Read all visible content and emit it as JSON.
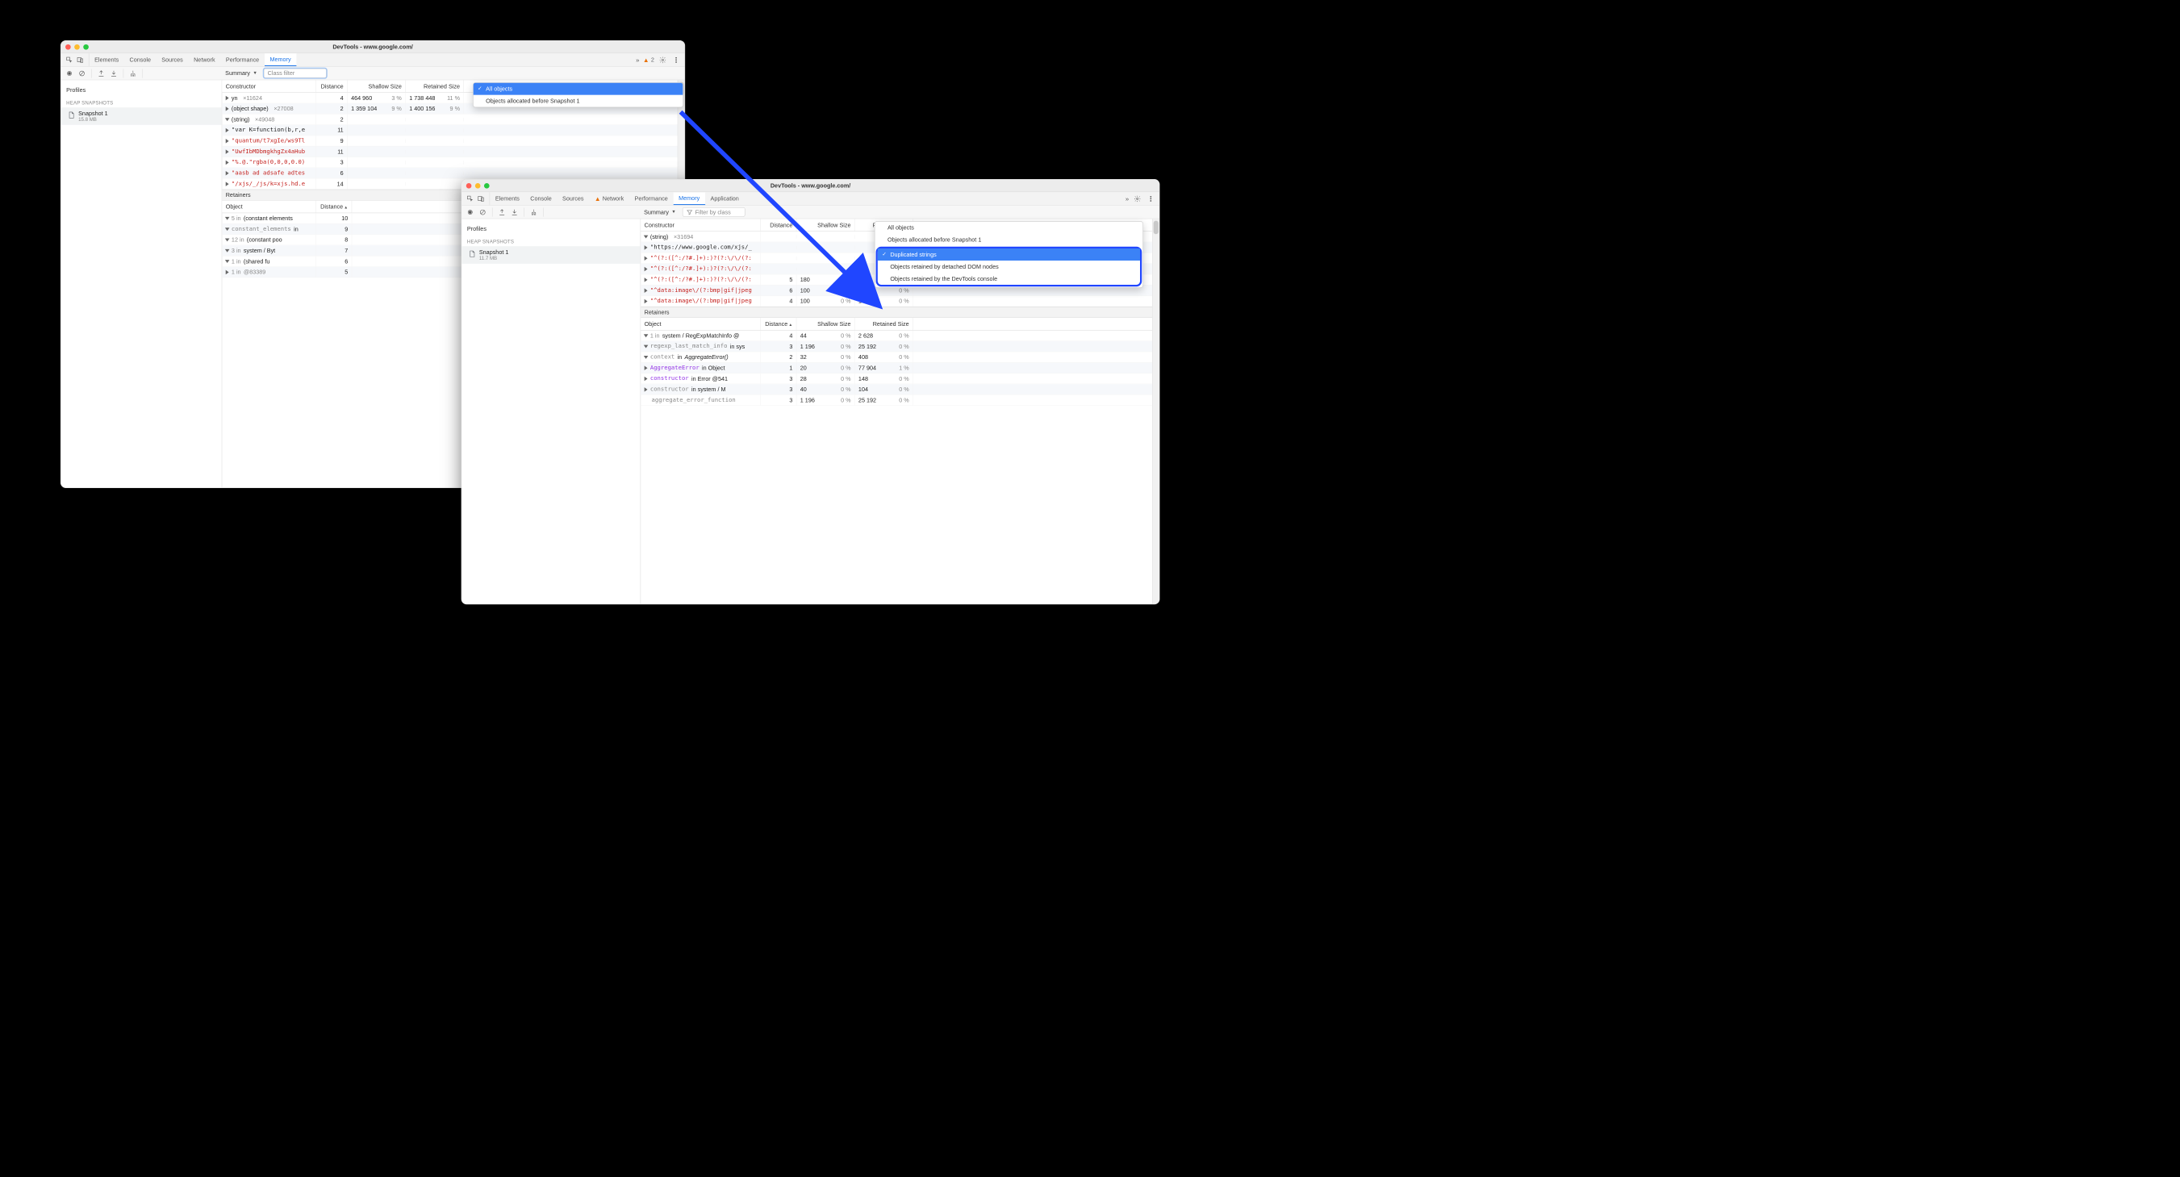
{
  "window1": {
    "title": "DevTools - www.google.com/",
    "tabs": [
      "Elements",
      "Console",
      "Sources",
      "Network",
      "Performance",
      "Memory"
    ],
    "active_tab": "Memory",
    "overflow_glyph": "»",
    "warn_count": "2",
    "toolbar": {
      "summary": "Summary",
      "class_filter_placeholder": "Class filter"
    },
    "dropdown": {
      "items": [
        "All objects",
        "Objects allocated before Snapshot 1"
      ],
      "selected": "All objects"
    },
    "sidebar": {
      "hdr": "Profiles",
      "section": "HEAP SNAPSHOTS",
      "snapshot": {
        "name": "Snapshot 1",
        "size": "15.8 MB"
      }
    },
    "constructors": {
      "headers": [
        "Constructor",
        "Distance",
        "Shallow Size",
        "Retained Size"
      ],
      "rows": [
        {
          "tri": "closed",
          "indent": 0,
          "label": "yn",
          "xcount": "×11624",
          "distance": "4",
          "shallow": "464 960",
          "shallow_pct": "3 %",
          "retained": "1 738 448",
          "retained_pct": "11 %"
        },
        {
          "tri": "closed",
          "indent": 0,
          "label": "(object shape)",
          "xcount": "×27008",
          "distance": "2",
          "shallow": "1 359 104",
          "shallow_pct": "9 %",
          "retained": "1 400 156",
          "retained_pct": "9 %"
        },
        {
          "tri": "open",
          "indent": 0,
          "label": "(string)",
          "xcount": "×49048",
          "distance": "2"
        },
        {
          "tri": "closed",
          "indent": 1,
          "mono": true,
          "red": false,
          "label": "\"var K=function(b,r,e",
          "distance": "11"
        },
        {
          "tri": "closed",
          "indent": 1,
          "mono": true,
          "red": true,
          "label": "\"quantum/t7xgIe/ws9Tl",
          "distance": "9"
        },
        {
          "tri": "closed",
          "indent": 1,
          "mono": true,
          "red": true,
          "label": "\"UwfIbMDbmgkhgZx4aHub",
          "distance": "11"
        },
        {
          "tri": "closed",
          "indent": 1,
          "mono": true,
          "red": true,
          "label": "\"%.@.\"rgba(0,0,0,0.0)",
          "distance": "3"
        },
        {
          "tri": "closed",
          "indent": 1,
          "mono": true,
          "red": true,
          "label": "\"aasb ad adsafe adtes",
          "distance": "6"
        },
        {
          "tri": "closed",
          "indent": 1,
          "mono": true,
          "red": true,
          "label": "\"/xjs/_/js/k=xjs.hd.e",
          "distance": "14"
        }
      ]
    },
    "retainers": {
      "title": "Retainers",
      "headers": [
        "Object",
        "Distance"
      ],
      "rows": [
        {
          "tri": "open",
          "indent": 0,
          "prefix_grey": "5 in ",
          "label": "(constant elements",
          "distance": "10"
        },
        {
          "tri": "open",
          "indent": 1,
          "mono": true,
          "grey": true,
          "label": "constant_elements",
          "suffix": " in",
          "distance": "9"
        },
        {
          "tri": "open",
          "indent": 2,
          "prefix_grey": "12 in ",
          "label": "(constant poo",
          "distance": "8"
        },
        {
          "tri": "open",
          "indent": 3,
          "prefix_grey": "3 in ",
          "label": "system / Byt",
          "distance": "7"
        },
        {
          "tri": "open",
          "indent": 4,
          "prefix_grey": "1 in ",
          "label": "(shared fu",
          "distance": "6"
        },
        {
          "tri": "closed",
          "indent": 5,
          "prefix_grey": "1 in ",
          "grey_label": "@83389",
          "distance": "5"
        }
      ]
    }
  },
  "window2": {
    "title": "DevTools - www.google.com/",
    "tabs": [
      "Elements",
      "Console",
      "Sources",
      "Network",
      "Performance",
      "Memory",
      "Application"
    ],
    "active_tab": "Memory",
    "warn_on_tab": "Network",
    "overflow_glyph": "»",
    "toolbar": {
      "summary": "Summary",
      "filter_placeholder": "Filter by class"
    },
    "dropdown": {
      "items_top": [
        "All objects",
        "Objects allocated before Snapshot 1"
      ],
      "items_bottom": [
        "Duplicated strings",
        "Objects retained by detached DOM nodes",
        "Objects retained by the DevTools console"
      ],
      "selected": "Duplicated strings"
    },
    "sidebar": {
      "hdr": "Profiles",
      "section": "HEAP SNAPSHOTS",
      "snapshot": {
        "name": "Snapshot 1",
        "size": "11.7 MB"
      }
    },
    "constructors": {
      "headers": [
        "Constructor",
        "Distance",
        "Shallow Size",
        "Retained Size"
      ],
      "rows": [
        {
          "tri": "open",
          "indent": 0,
          "label": "(string)",
          "xcount": "×31694"
        },
        {
          "tri": "closed",
          "indent": 1,
          "mono": true,
          "label": "\"https://www.google.com/xjs/_"
        },
        {
          "tri": "closed",
          "indent": 1,
          "mono": true,
          "red": true,
          "label": "\"^(?:([^:/?#.]+):)?(?:\\/\\/(?:"
        },
        {
          "tri": "closed",
          "indent": 1,
          "mono": true,
          "red": true,
          "label": "\"^(?:([^:/?#.]+):)?(?:\\/\\/(?:"
        },
        {
          "tri": "closed",
          "indent": 1,
          "mono": true,
          "red": true,
          "label": "\"^(?:([^:/?#.]+):)?(?:\\/\\/(?:",
          "distance": "5",
          "shallow": "180",
          "shallow_pct": "0 %",
          "retained": "180",
          "retained_pct": "0 %"
        },
        {
          "tri": "closed",
          "indent": 1,
          "mono": true,
          "red": true,
          "label": "\"^data:image\\/(?:bmp|gif|jpeg",
          "distance": "6",
          "shallow": "100",
          "shallow_pct": "0 %",
          "retained": "100",
          "retained_pct": "0 %"
        },
        {
          "tri": "closed",
          "indent": 1,
          "mono": true,
          "red": true,
          "label": "\"^data:image\\/(?:bmp|gif|jpeg",
          "distance": "4",
          "shallow": "100",
          "shallow_pct": "0 %",
          "retained": "100",
          "retained_pct": "0 %"
        }
      ]
    },
    "retainers": {
      "title": "Retainers",
      "headers": [
        "Object",
        "Distance",
        "Shallow Size",
        "Retained Size"
      ],
      "rows": [
        {
          "tri": "open",
          "indent": 0,
          "prefix_grey": "1 in ",
          "label": "system / RegExpMatchInfo @",
          "distance": "4",
          "shallow": "44",
          "shallow_pct": "0 %",
          "retained": "2 628",
          "retained_pct": "0 %"
        },
        {
          "tri": "open",
          "indent": 1,
          "mono": true,
          "grey": true,
          "label": "regexp_last_match_info",
          "suffix": " in sys",
          "distance": "3",
          "shallow": "1 196",
          "shallow_pct": "0 %",
          "retained": "25 192",
          "retained_pct": "0 %"
        },
        {
          "tri": "open",
          "indent": 2,
          "mono": true,
          "grey": true,
          "label": "context",
          "suffix_italic": "AggregateError()",
          "suffix_prefix": " in ",
          "distance": "2",
          "shallow": "32",
          "shallow_pct": "0 %",
          "retained": "408",
          "retained_pct": "0 %"
        },
        {
          "tri": "closed",
          "indent": 3,
          "purple": true,
          "mono": true,
          "label": "AggregateError",
          "suffix": " in Object",
          "distance": "1",
          "shallow": "20",
          "shallow_pct": "0 %",
          "retained": "77 904",
          "retained_pct": "1 %"
        },
        {
          "tri": "closed",
          "indent": 3,
          "purple": true,
          "mono": true,
          "label": "constructor",
          "suffix": " in Error @541",
          "distance": "3",
          "shallow": "28",
          "shallow_pct": "0 %",
          "retained": "148",
          "retained_pct": "0 %"
        },
        {
          "tri": "closed",
          "indent": 3,
          "grey": true,
          "mono": true,
          "label": "constructor",
          "suffix": " in system / M",
          "distance": "3",
          "shallow": "40",
          "shallow_pct": "0 %",
          "retained": "104",
          "retained_pct": "0 %"
        },
        {
          "tri": "none",
          "indent": 3,
          "grey": true,
          "mono": true,
          "label": "aggregate_error_function",
          "distance": "3",
          "shallow": "1 196",
          "shallow_pct": "0 %",
          "retained": "25 192",
          "retained_pct": "0 %"
        }
      ]
    }
  }
}
